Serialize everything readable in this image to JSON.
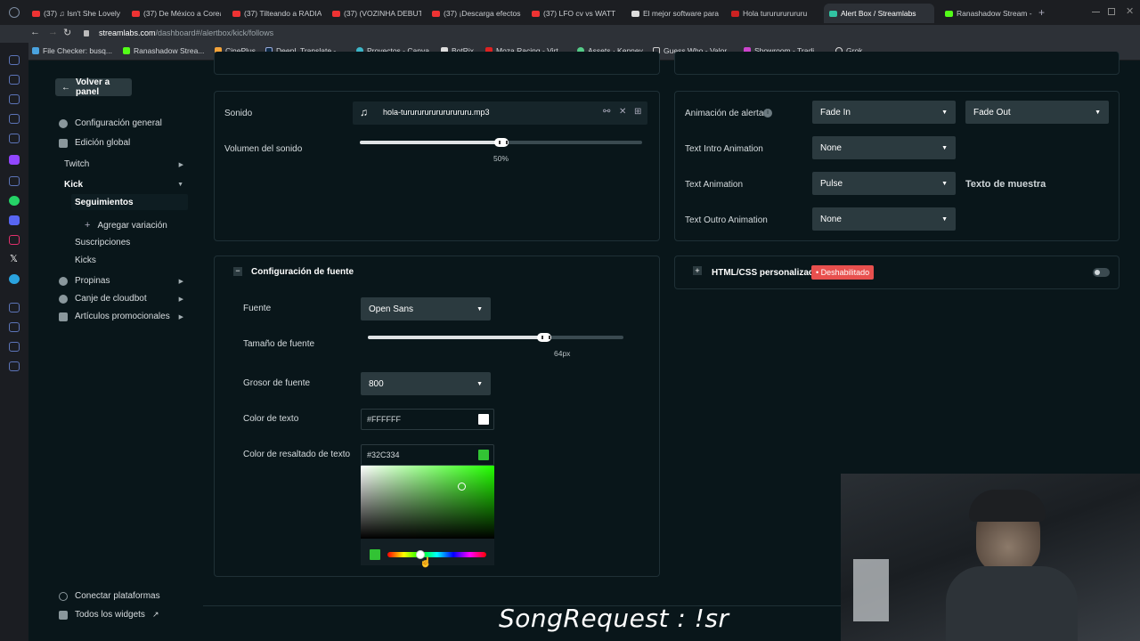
{
  "browser": {
    "tabs": [
      {
        "label": "(37) ♫ Isn't She Lovely"
      },
      {
        "label": "(37) De México a Corea"
      },
      {
        "label": "(37) Tilteando a RADIA"
      },
      {
        "label": "(37) (VOZINHA DEBUT"
      },
      {
        "label": "(37) ¡Descarga efectos"
      },
      {
        "label": "(37) LFO cv vs WATT"
      },
      {
        "label": "El mejor software para"
      },
      {
        "label": "Hola tururururururu"
      },
      {
        "label": "Alert Box / Streamlabs"
      },
      {
        "label": "Ranashadow Stream -"
      }
    ],
    "url_host": "streamlabs.com",
    "url_path": "/dashboard#/alertbox/kick/follows",
    "bookmarks": [
      {
        "label": "File Checker: busq..."
      },
      {
        "label": "Ranashadow Strea..."
      },
      {
        "label": "CinePlus"
      },
      {
        "label": "DeepL Translate -..."
      },
      {
        "label": "Proyectos - Canva"
      },
      {
        "label": "BotRix"
      },
      {
        "label": "Moza Racing - Virt..."
      },
      {
        "label": "Assets · Kenney"
      },
      {
        "label": "Guess Who - Valor..."
      },
      {
        "label": "Showroom - Tradi..."
      },
      {
        "label": "Grok"
      }
    ]
  },
  "sidebar": {
    "back_label": "Volver a panel",
    "general": "Configuración general",
    "global": "Edición global",
    "twitch": "Twitch",
    "kick": "Kick",
    "seguimientos": "Seguimientos",
    "add_variation": "Agregar variación",
    "suscripciones": "Suscripciones",
    "kicks": "Kicks",
    "propinas": "Propinas",
    "canje": "Canje de cloudbot",
    "promo": "Artículos promocionales",
    "connect": "Conectar plataformas",
    "widgets": "Todos los widgets"
  },
  "sound": {
    "label": "Sonido",
    "file": "hola-turururururururururu.mp3",
    "volume_label": "Volumen del sonido",
    "volume_value": "50%",
    "volume_pct": 50
  },
  "font": {
    "section_title": "Configuración de fuente",
    "font_label": "Fuente",
    "font_value": "Open Sans",
    "size_label": "Tamaño de fuente",
    "size_value": "64px",
    "size_pct": 69,
    "weight_label": "Grosor de fuente",
    "weight_value": "800",
    "text_color_label": "Color de texto",
    "text_color_value": "#FFFFFF",
    "highlight_label": "Color de resaltado de texto",
    "highlight_value": "#32C334"
  },
  "animation": {
    "alert_label": "Animación de alerta",
    "alert_in": "Fade In",
    "alert_out": "Fade Out",
    "intro_label": "Text Intro Animation",
    "intro_value": "None",
    "text_label": "Text Animation",
    "text_value": "Pulse",
    "sample_text": "Texto de muestra",
    "outro_label": "Text Outro Animation",
    "outro_value": "None"
  },
  "custom_css": {
    "label": "HTML/CSS personalizado",
    "badge": "• Deshabilitado"
  },
  "overlay_text": "SongRequest : !sr",
  "colors": {
    "accent_green": "#32C334",
    "badge_red": "#e8504e",
    "panel_bg": "#09161a",
    "control_bg": "#2b3a3f"
  }
}
